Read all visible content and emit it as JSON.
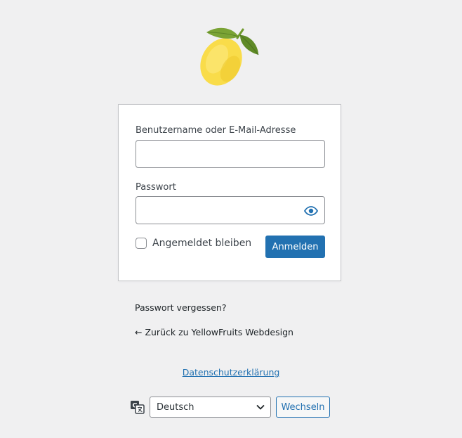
{
  "login": {
    "username_label": "Benutzername oder E-Mail-Adresse",
    "username_value": "",
    "password_label": "Passwort",
    "password_value": "",
    "remember_label": "Angemeldet bleiben",
    "remember_checked": false,
    "submit_label": "Anmelden"
  },
  "links": {
    "lost_password": "Passwort vergessen?",
    "back_to_site": "← Zurück zu YellowFruits Webdesign",
    "privacy_policy": "Datenschutzerklärung"
  },
  "language": {
    "selected": "Deutsch",
    "switch_label": "Wechseln"
  },
  "icons": {
    "logo": "lemon-logo",
    "password_toggle": "eye-icon",
    "language": "translate-icon",
    "select_caret": "chevron-down-icon"
  },
  "colors": {
    "background": "#f0f0f1",
    "primary": "#2271b1",
    "lemon": "#f9dc4a",
    "leaf": "#6f9a2c"
  }
}
